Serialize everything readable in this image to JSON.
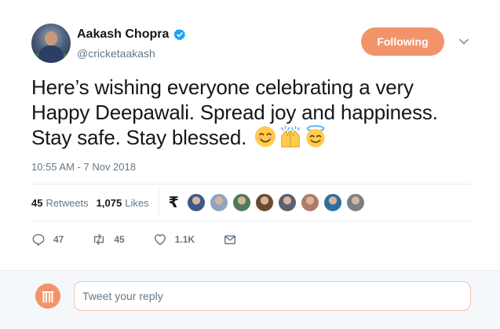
{
  "author": {
    "display_name": "Aakash Chopra",
    "handle": "@cricketaakash",
    "verified": true
  },
  "follow_button": {
    "label": "Following",
    "color": "#f3936a"
  },
  "tweet": {
    "text": "Here’s wishing everyone celebrating a very Happy Deepawali. Spread joy and happiness. Stay safe. Stay blessed.",
    "emojis": [
      "smiling-face-with-smiling-eyes",
      "raising-hands",
      "smiling-face-with-halo"
    ],
    "timestamp": "10:55 AM - 7 Nov 2018"
  },
  "stats": {
    "retweets_count": "45",
    "retweets_label": "Retweets",
    "likes_count": "1,075",
    "likes_label": "Likes",
    "sponsor_glyph": "₹",
    "liker_avatar_colors": [
      "#3d5a8a",
      "#8fa3c4",
      "#4f7a5c",
      "#6b4a2e",
      "#5a5f73",
      "#b07a6a",
      "#2f6f9f",
      "#7a7e86"
    ]
  },
  "actions": {
    "reply_count": "47",
    "retweet_count": "45",
    "like_count": "1.1K"
  },
  "reply": {
    "placeholder": "Tweet your reply"
  },
  "colors": {
    "accent": "#f3936a",
    "secondary_text": "#657786",
    "verified_blue": "#1da1f2"
  }
}
